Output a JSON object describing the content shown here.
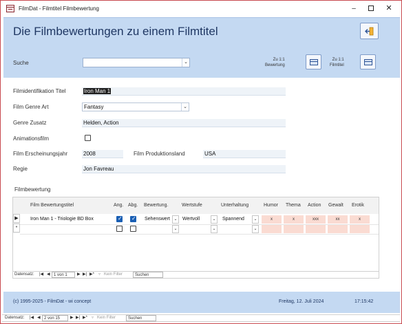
{
  "window": {
    "title": "FilmDat - Filmtitel Filmbewertung",
    "minimize": "–",
    "close": "✕"
  },
  "header": {
    "title": "Die Filmbewertungen zu einem Filmtitel",
    "search_label": "Suche",
    "search_value": "",
    "goto_bewertung": {
      "line1": "Zu 1:1",
      "line2": "Bewertung"
    },
    "goto_filmtitel": {
      "line1": "Zu 1:1",
      "line2": "Filmtitel"
    }
  },
  "form": {
    "identifikation_label": "Filmidentifikation Titel",
    "identifikation_value": "Iron Man 1",
    "genre_label": "Film Genre Art",
    "genre_value": "Fantasy",
    "genre_zusatz_label": "Genre Zusatz",
    "genre_zusatz_value": "Helden, Action",
    "animationsfilm_label": "Animationsfilm",
    "animationsfilm_checked": false,
    "jahr_label": "Film Erscheinungsjahr",
    "jahr_value": "2008",
    "land_label": "Film Produktionsland",
    "land_value": "USA",
    "regie_label": "Regie",
    "regie_value": "Jon Favreau"
  },
  "subform": {
    "label": "Filmbewertung",
    "columns": {
      "titel": "Film Bewertungstitel",
      "ang": "Ang.",
      "abg": "Abg.",
      "bewertung": "Bewertung.",
      "wertstufe": "Wertstufe",
      "unterhaltung": "Unterhaltung",
      "humor": "Humor",
      "thema": "Thema",
      "action": "Action",
      "gewalt": "Gewalt",
      "erotik": "Erotik"
    },
    "rows": [
      {
        "titel": "Iron Man 1 - Triologie BD Box",
        "ang": true,
        "abg": true,
        "bewertung": "Sehenswert",
        "wertstufe": "Wertvoll",
        "unterhaltung": "Spannend",
        "humor": "x",
        "thema": "x",
        "action": "xxx",
        "gewalt": "xx",
        "erotik": "x"
      }
    ],
    "new_row_marker": "*",
    "current_row_marker": "▶",
    "nav": {
      "label": "Datensatz:",
      "first": "|◀",
      "prev": "◀",
      "position": "1 von 1",
      "next": "▶",
      "last": "▶|",
      "new": "▶*",
      "filter": "Kein Filter",
      "search": "Suchen"
    }
  },
  "footer": {
    "copyright": "(c) 1995-2025 - FilmDat - wi concept",
    "date": "Freitag, 12. Juli 2024",
    "time": "17:15:42"
  },
  "main_nav": {
    "label": "Datensatz:",
    "first": "|◀",
    "prev": "◀",
    "position": "2 von 15",
    "next": "▶",
    "last": "▶|",
    "new": "▶*",
    "filter": "Kein Filter",
    "search": "Suchen"
  },
  "colors": {
    "header_bg": "#c4d9f2",
    "title_color": "#1f3763",
    "rating_cell": "#fadbd2",
    "checkbox_on": "#1a5fb4",
    "window_border": "#c8494f"
  },
  "icons": [
    "app-icon",
    "exit-icon",
    "form-view-icon",
    "chevron-down-icon",
    "filter-icon"
  ]
}
